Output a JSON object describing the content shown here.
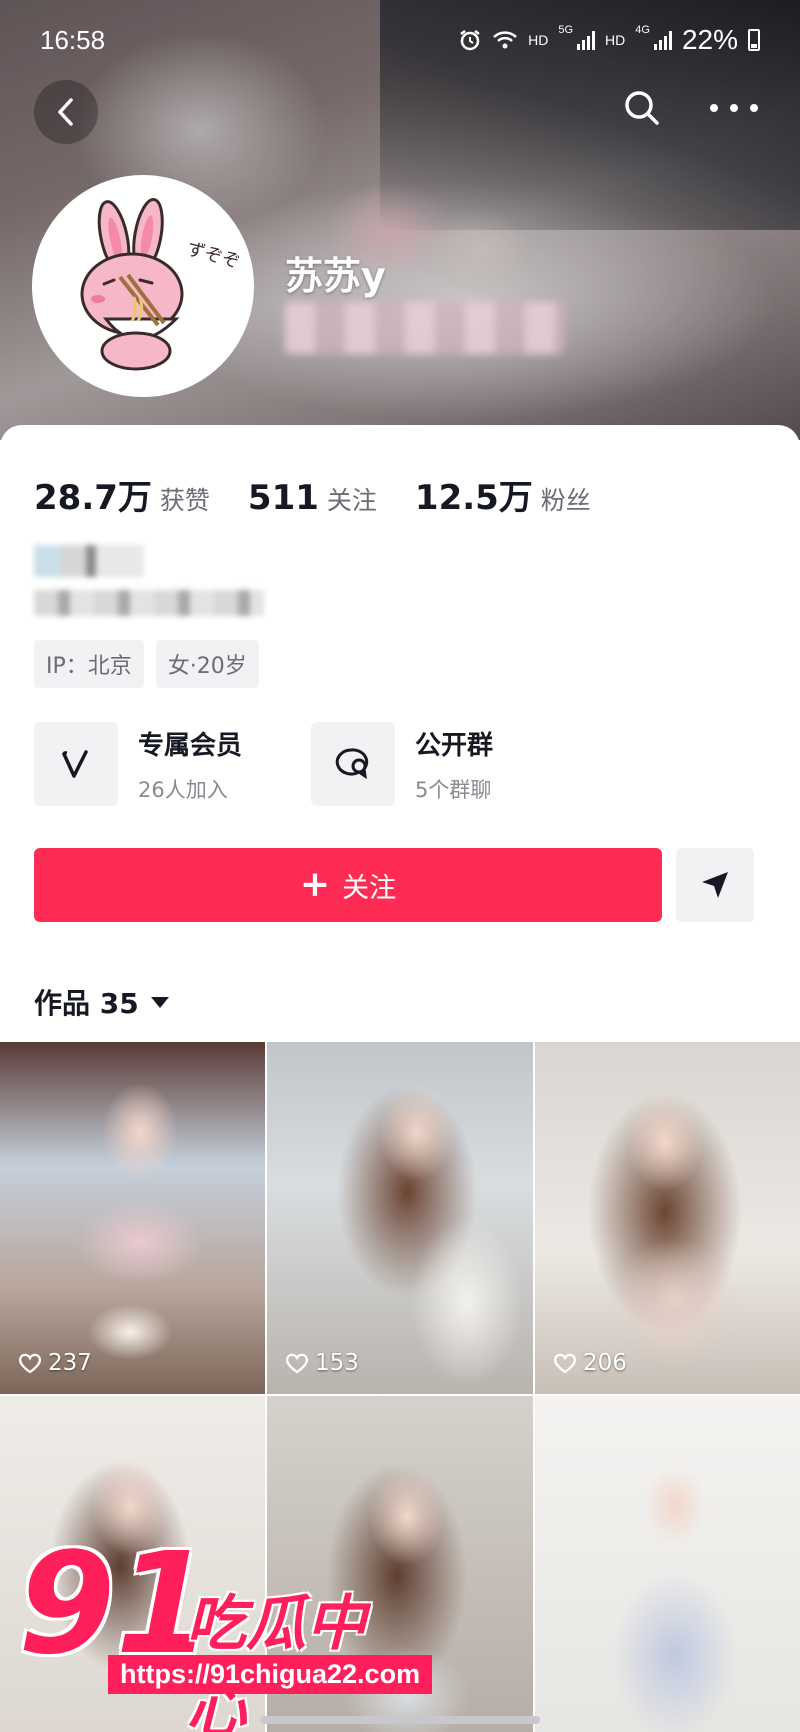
{
  "status_bar": {
    "time": "16:58",
    "net1": "HD",
    "net1_gen": "5G",
    "net2": "HD",
    "net2_gen": "4G",
    "battery": "22%"
  },
  "header": {
    "icons": [
      "back-icon",
      "search-icon",
      "more-icon"
    ]
  },
  "profile": {
    "nickname": "苏苏y",
    "stats": [
      {
        "value": "28.7万",
        "label": "获赞"
      },
      {
        "value": "511",
        "label": "关注"
      },
      {
        "value": "12.5万",
        "label": "粉丝"
      }
    ],
    "tags": [
      "IP：北京",
      "女·20岁"
    ]
  },
  "features": [
    {
      "title": "专属会员",
      "subtitle": "26人加入",
      "icon": "v-icon"
    },
    {
      "title": "公开群",
      "subtitle": "5个群聊",
      "icon": "chat-group-icon"
    }
  ],
  "actions": {
    "follow_label": "关注",
    "follow_prefix": "+"
  },
  "works": {
    "label": "作品 35",
    "tiles": [
      {
        "likes": "237"
      },
      {
        "likes": "153"
      },
      {
        "likes": "206"
      },
      {
        "likes": ""
      },
      {
        "likes": ""
      },
      {
        "likes": ""
      }
    ]
  },
  "watermark": {
    "number": "91",
    "brand": "吃瓜中心",
    "url": "https://91chigua22.com"
  },
  "colors": {
    "primary": "#fe2c55",
    "watermark": "#ff1f5a",
    "muted_text": "#6b6d75",
    "chip_bg": "#f2f2f4"
  }
}
